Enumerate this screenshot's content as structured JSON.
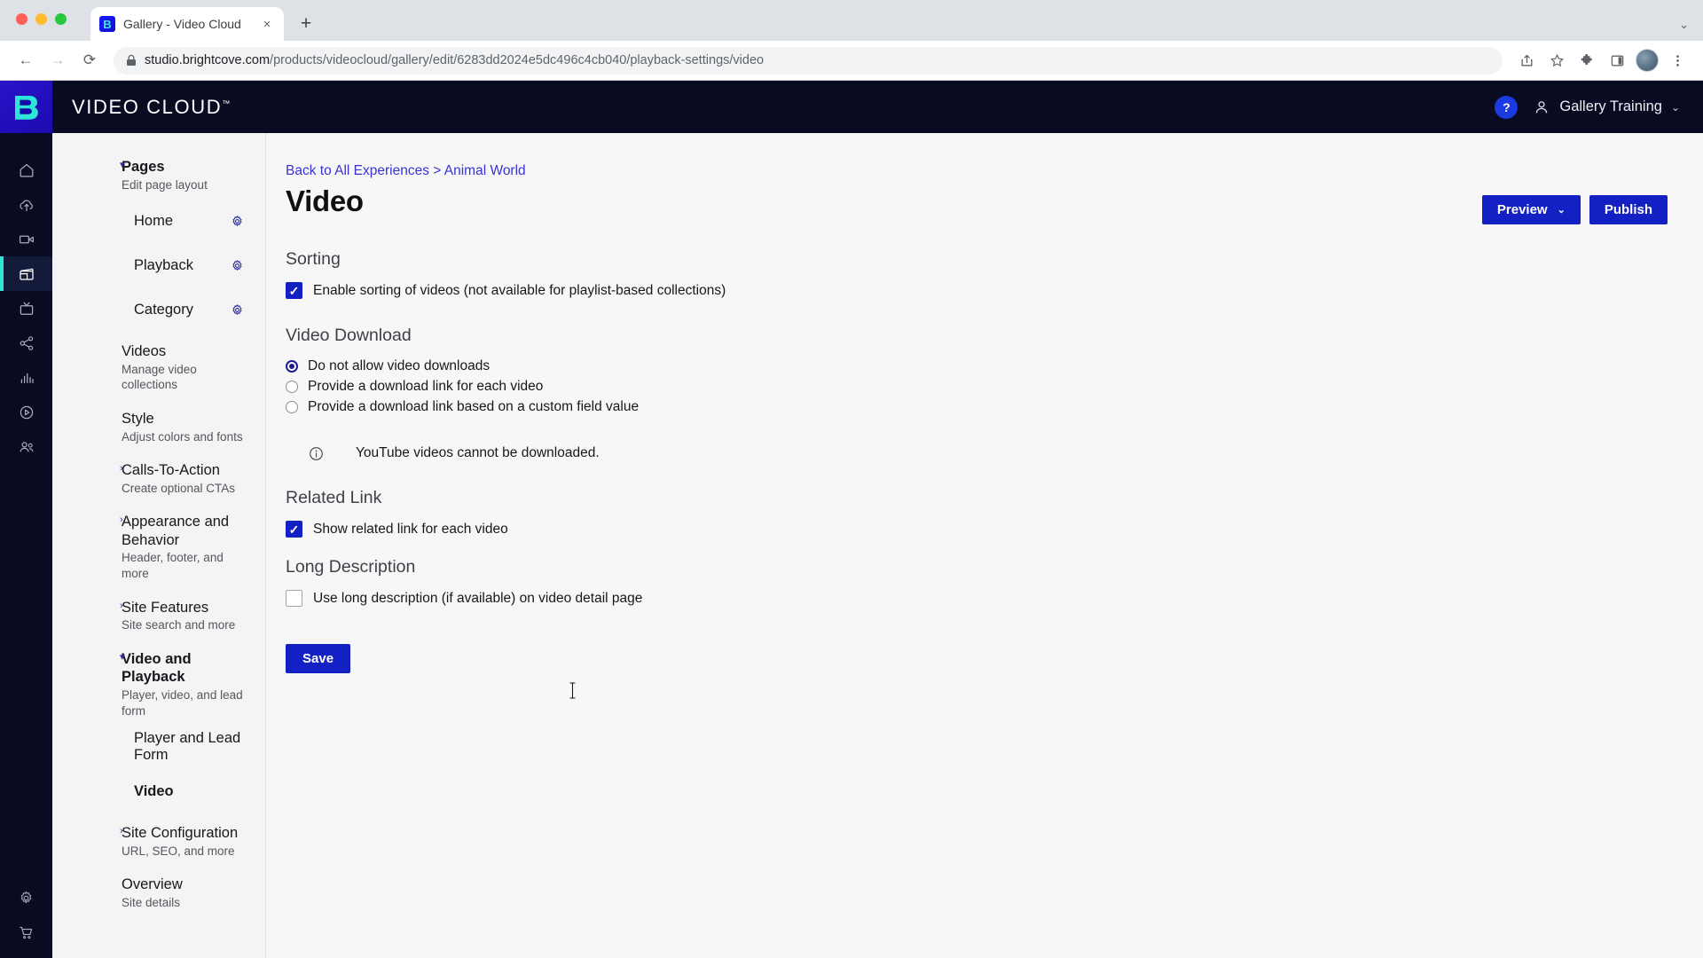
{
  "browser": {
    "tab": {
      "title": "Gallery - Video Cloud",
      "favicon": "B",
      "close_label": "×"
    },
    "new_tab_label": "+",
    "nav": {
      "back": "←",
      "forward": "→",
      "reload": "⟳"
    },
    "omnibox": {
      "url_domain": "studio.brightcove.com",
      "url_path": "/products/videocloud/gallery/edit/6283dd2024e5dc496c4cb040/playback-settings/video"
    },
    "toolbar_icons": [
      "share-icon",
      "bookmark-star-icon",
      "extensions-puzzle-icon",
      "side-panel-icon",
      "profile-avatar",
      "chrome-menu-icon"
    ],
    "window_menu_caret": "⌄"
  },
  "app": {
    "brand": "VIDEO CLOUD",
    "brand_tm": "™",
    "help_label": "?",
    "account_name": "Gallery Training",
    "account_caret": "⌄"
  },
  "rail": {
    "logo_letter": "B",
    "items": [
      {
        "name": "home-icon",
        "label": "Home"
      },
      {
        "name": "upload-cloud-icon",
        "label": "Upload"
      },
      {
        "name": "video-camera-icon",
        "label": "Media"
      },
      {
        "name": "gallery-icon",
        "label": "Gallery",
        "active": true
      },
      {
        "name": "tv-broadcast-icon",
        "label": "Live"
      },
      {
        "name": "share-network-icon",
        "label": "Social"
      },
      {
        "name": "analytics-bars-icon",
        "label": "Analytics"
      },
      {
        "name": "player-circle-icon",
        "label": "Players"
      },
      {
        "name": "users-icon",
        "label": "Audience"
      }
    ],
    "bottom_items": [
      {
        "name": "gear-icon",
        "label": "Admin"
      },
      {
        "name": "shopping-cart-icon",
        "label": "Marketplace"
      }
    ]
  },
  "subnav": {
    "groups": [
      {
        "title": "Pages",
        "subtitle": "Edit page layout",
        "bold": true,
        "caret": "expanded",
        "children": [
          {
            "label": "Home",
            "gear": true
          },
          {
            "label": "Playback",
            "gear": true
          },
          {
            "label": "Category",
            "gear": true
          }
        ]
      },
      {
        "title": "Videos",
        "subtitle": "Manage video collections",
        "bold": false,
        "caret": "none",
        "children": []
      },
      {
        "title": "Style",
        "subtitle": "Adjust colors and fonts",
        "bold": false,
        "caret": "none",
        "children": []
      },
      {
        "title": "Calls-To-Action",
        "subtitle": "Create optional CTAs",
        "bold": false,
        "caret": "collapsed",
        "children": []
      },
      {
        "title": "Appearance and Behavior",
        "subtitle": "Header, footer, and more",
        "bold": false,
        "caret": "collapsed",
        "children": []
      },
      {
        "title": "Site Features",
        "subtitle": "Site search and more",
        "bold": false,
        "caret": "collapsed",
        "children": []
      },
      {
        "title": "Video and Playback",
        "subtitle": "Player, video, and lead form",
        "bold": true,
        "caret": "expanded",
        "children": [
          {
            "label": "Player and Lead Form",
            "gear": false,
            "bold": false
          },
          {
            "label": "Video",
            "gear": false,
            "bold": true
          }
        ]
      },
      {
        "title": "Site Configuration",
        "subtitle": "URL, SEO, and more",
        "bold": false,
        "caret": "collapsed",
        "children": []
      },
      {
        "title": "Overview",
        "subtitle": "Site details",
        "bold": false,
        "caret": "none",
        "children": []
      }
    ]
  },
  "main": {
    "breadcrumb": "Back to All Experiences > Animal World",
    "page_title": "Video",
    "preview_label": "Preview",
    "preview_caret": "⌄",
    "publish_label": "Publish",
    "sections": {
      "sorting": {
        "heading": "Sorting",
        "checkbox_label": "Enable sorting of videos (not available for playlist-based collections)",
        "checked": true
      },
      "video_download": {
        "heading": "Video Download",
        "options": [
          {
            "label": "Do not allow video downloads",
            "selected": true
          },
          {
            "label": "Provide a download link for each video",
            "selected": false
          },
          {
            "label": "Provide a download link based on a custom field value",
            "selected": false
          }
        ],
        "note_icon": "info-circle-icon",
        "note": "YouTube videos cannot be downloaded."
      },
      "related_link": {
        "heading": "Related Link",
        "checkbox_label": "Show related link for each video",
        "checked": true
      },
      "long_description": {
        "heading": "Long Description",
        "checkbox_label": "Use long description (if available) on video detail page",
        "checked": false
      }
    },
    "save_label": "Save"
  },
  "colors": {
    "brand_blue": "#1320c4",
    "accent_teal": "#2ee6d6",
    "rail_dark": "#090b22",
    "link_blue": "#3a32d4",
    "page_bg": "#f7f7f8",
    "subnav_bg": "#f4f4f5"
  }
}
